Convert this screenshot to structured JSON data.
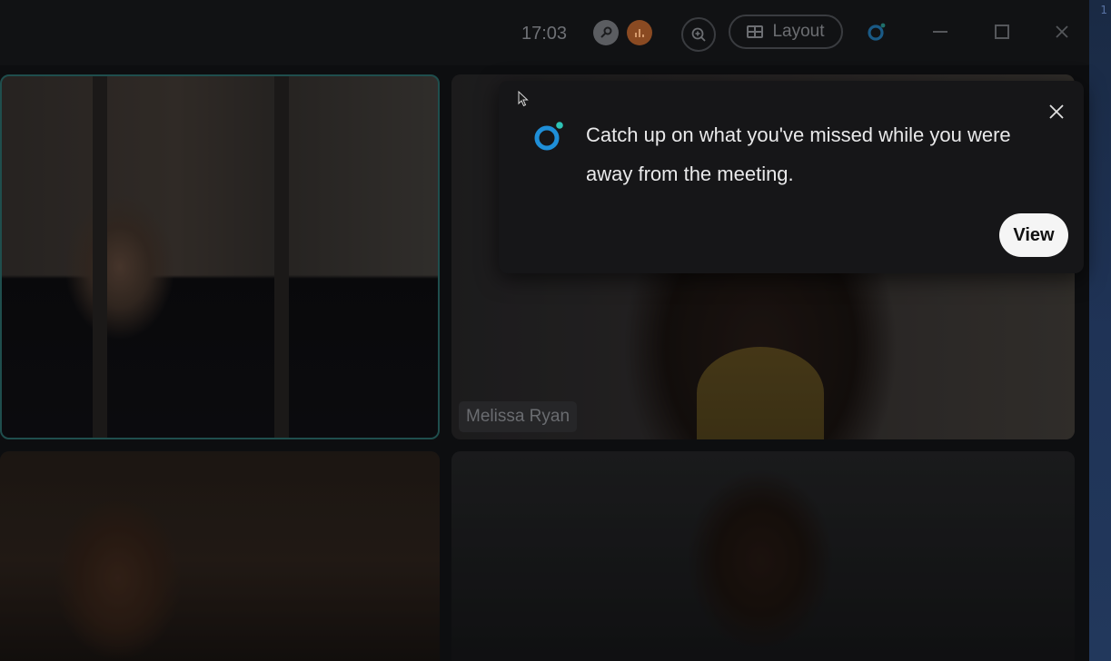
{
  "titlebar": {
    "time": "17:03",
    "layout_label": "Layout",
    "key_icon": "key-icon",
    "stats_icon": "stats-icon",
    "zoom_icon": "zoom-in-icon",
    "layout_icon": "grid-layout-icon",
    "assistant_icon": "ai-assistant-icon",
    "window_controls": [
      "minimize",
      "maximize",
      "close"
    ]
  },
  "edge": {
    "digit": "1"
  },
  "tiles": [
    {
      "name": "",
      "active": true
    },
    {
      "name": "Melissa Ryan",
      "active": false
    },
    {
      "name": "",
      "active": false
    },
    {
      "name": "",
      "active": false
    }
  ],
  "popup": {
    "message": "Catch up on what you've missed while you were away from the meeting.",
    "view_label": "View",
    "close_icon": "close-icon",
    "logo_icon": "ai-assistant-icon"
  },
  "colors": {
    "accent_blue": "#1f8fd8",
    "accent_teal": "#2ec4b6",
    "active_border": "#1f4e4d",
    "popup_bg": "#161618",
    "view_button_bg": "#f5f5f5"
  }
}
